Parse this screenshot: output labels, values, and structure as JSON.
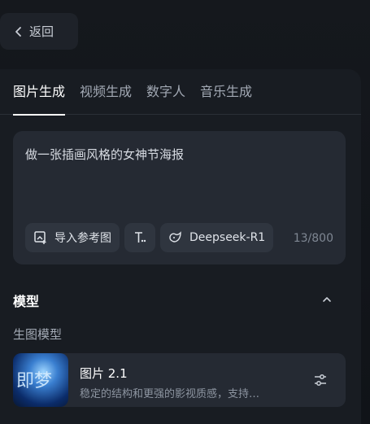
{
  "back": {
    "label": "返回"
  },
  "tabs": [
    {
      "label": "图片生成",
      "active": true
    },
    {
      "label": "视频生成",
      "active": false
    },
    {
      "label": "数字人",
      "active": false
    },
    {
      "label": "音乐生成",
      "active": false
    }
  ],
  "prompt": {
    "text": "做一张插画风格的女神节海报",
    "counter": "13/800"
  },
  "tools": {
    "import_ref_label": "导入参考图",
    "model_chip_label": "Deepseek-R1",
    "icons": [
      "image-import-icon",
      "text-format-icon",
      "deepseek-icon"
    ]
  },
  "model_section": {
    "title": "模型",
    "subtitle": "生图模型",
    "card": {
      "name": "图片 2.1",
      "description": "稳定的结构和更强的影视质感，支持…",
      "thumb_text": "即梦"
    }
  },
  "colors": {
    "background": "#15181d",
    "panel": "#181c22",
    "input": "#252a33",
    "chip": "#2f353f"
  }
}
